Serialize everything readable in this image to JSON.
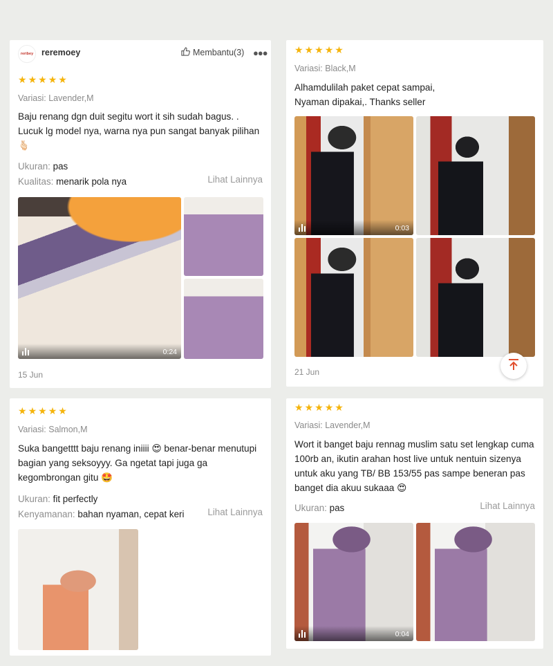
{
  "reviews": [
    {
      "user": {
        "name": "reremoey",
        "avatar_text": "reribey"
      },
      "helpful_label": "Membantu(3)",
      "stars": [
        "★",
        "★",
        "★",
        "★",
        "★"
      ],
      "variation": "Variasi: Lavender,M",
      "text": "Baju renang dgn duit segitu wort it sih sudah bagus. . Lucuk lg model nya, warna nya pun sangat banyak pilihan 🫰🏻",
      "attrs": [
        {
          "key": "Ukuran:",
          "value": "pas"
        },
        {
          "key": "Kualitas:",
          "value": "menarik pola nya"
        }
      ],
      "more_label": "Lihat Lainnya",
      "video_duration": "0:24",
      "date": "15 Jun"
    },
    {
      "stars": [
        "★",
        "★",
        "★",
        "★",
        "★"
      ],
      "variation": "Variasi: Black,M",
      "text": "Alhamdulilah paket cepat sampai, Nyaman dipakai,. Thanks seller",
      "video_duration": "0:03",
      "date": "21 Jun"
    },
    {
      "stars": [
        "★",
        "★",
        "★",
        "★",
        "★"
      ],
      "variation": "Variasi: Salmon,M",
      "text": "Suka bangetttt baju renang iniiii 😍 benar-benar menutupi bagian yang seksoyyy. Ga ngetat tapi juga ga kegombrongan gitu 🤩",
      "attrs": [
        {
          "key": "Ukuran:",
          "value": "fit perfectly"
        },
        {
          "key": "Kenyamanan:",
          "value": "bahan nyaman, cepat keri"
        }
      ],
      "more_label": "Lihat Lainnya"
    },
    {
      "stars": [
        "★",
        "★",
        "★",
        "★",
        "★"
      ],
      "variation": "Variasi: Lavender,M",
      "text": "Wort it banget baju rennag muslim satu set lengkap cuma 100rb an, ikutin arahan host live untuk nentuin sizenya untuk aku yang TB/ BB 153/55 pas sampe beneran pas banget dia akuu sukaaa 😍",
      "attrs": [
        {
          "key": "Ukuran:",
          "value": "pas"
        }
      ],
      "more_label": "Lihat Lainnya",
      "video_duration": "0:04"
    }
  ],
  "icons": {
    "like": "thumbs-up-icon",
    "more": "more-dots-icon",
    "video": "video-bars-icon",
    "scroll_top": "arrow-up-to-top-icon"
  },
  "colors": {
    "star": "#f5b40c",
    "background": "#ecedea",
    "scroll_top_arrow": "#e2502f"
  }
}
